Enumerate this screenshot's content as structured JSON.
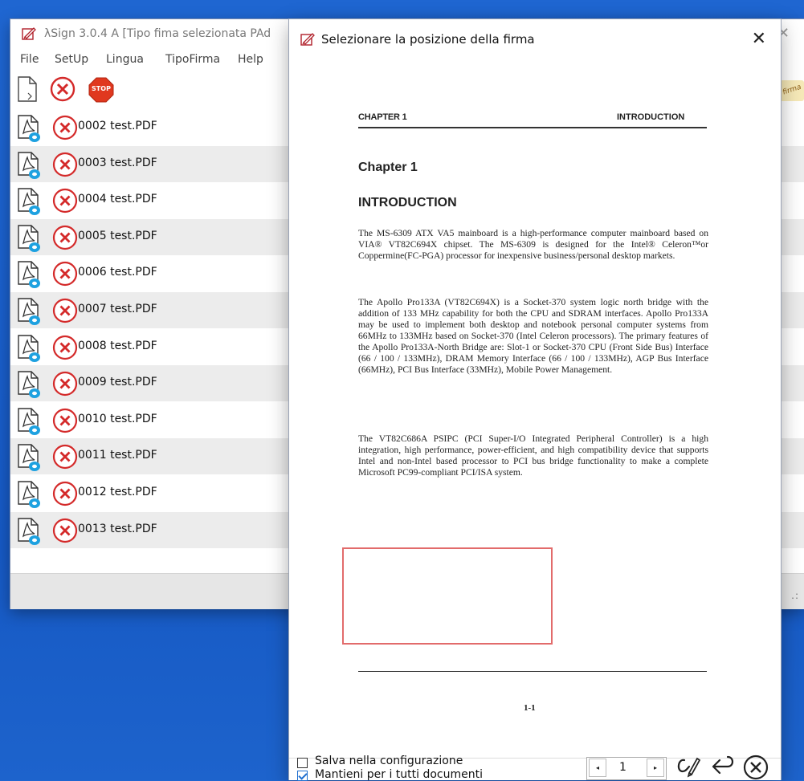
{
  "main_window": {
    "title": "λSign  3.0.4 A  [Tipo fima selezionata PAd",
    "close_glyph": "✕",
    "menu": [
      "File",
      "SetUp",
      "Lingua",
      "TipoFirma",
      "Help"
    ],
    "toolbar": {
      "new_icon": "document-icon",
      "cancel_icon": "cancel-circle-icon",
      "stop_label": "STOP"
    },
    "files": [
      {
        "name": "0002 test.PDF"
      },
      {
        "name": "0003 test.PDF"
      },
      {
        "name": "0004 test.PDF"
      },
      {
        "name": "0005 test.PDF"
      },
      {
        "name": "0006 test.PDF"
      },
      {
        "name": "0007 test.PDF"
      },
      {
        "name": "0008 test.PDF"
      },
      {
        "name": "0009 test.PDF"
      },
      {
        "name": "0010 test.PDF"
      },
      {
        "name": "0011 test.PDF"
      },
      {
        "name": "0012 test.PDF"
      },
      {
        "name": "0013 test.PDF"
      }
    ],
    "status_grip": ".:"
  },
  "dialog": {
    "title": "Selezionare la posizione della firma",
    "close_glyph": "✕",
    "page": {
      "header_left": "CHAPTER 1",
      "header_right": "INTRODUCTION",
      "chapter": "Chapter 1",
      "heading": "INTRODUCTION",
      "para1": "The MS-6309 ATX VA5 mainboard is a high-performance computer mainboard based on VIA® VT82C694X chipset.  The MS-6309 is designed for the Intel® Celeron™or Coppermine(FC-PGA)  processor for inexpensive business/personal  desktop  markets.",
      "para2": "The Apollo Pro133A (VT82C694X) is a Socket-370 system logic north bridge with the addition of 133 MHz capability for both the CPU and SDRAM interfaces. Apollo Pro133A may be used to implement both desktop and notebook personal computer systems from 66MHz to 133MHz based on Socket-370 (Intel Celeron processors). The primary features of the Apollo Pro133A-North Bridge are: Slot-1 or Socket-370 CPU (Front Side Bus) Interface (66 / 100 / 133MHz), DRAM Memory Interface (66 / 100 / 133MHz), AGP Bus Interface (66MHz), PCI Bus Interface (33MHz), Mobile Power Management.",
      "para3": "The VT82C686A PSIPC (PCI Super-I/O Integrated Peripheral Controller) is a high integration, high performance, power-efficient, and high compatibility device that supports Intel and non-Intel based processor to PCI bus bridge functionality to make a complete Microsoft PC99-compliant PCI/ISA system.",
      "page_number": "1-1"
    },
    "bottom": {
      "save_config_label": "Salva nella configurazione",
      "save_config_checked": false,
      "keep_all_label": "Mantieni per i tutti documenti",
      "keep_all_checked": true,
      "current_page": "1",
      "prev_glyph": "◂",
      "next_glyph": "▸"
    }
  },
  "colors": {
    "desktop": "#1a5fcb",
    "cancel_red": "#d42a2a",
    "signature_box": "#e26b6b",
    "row_alt": "#ececec",
    "checkbox_blue": "#1e6fd0"
  }
}
